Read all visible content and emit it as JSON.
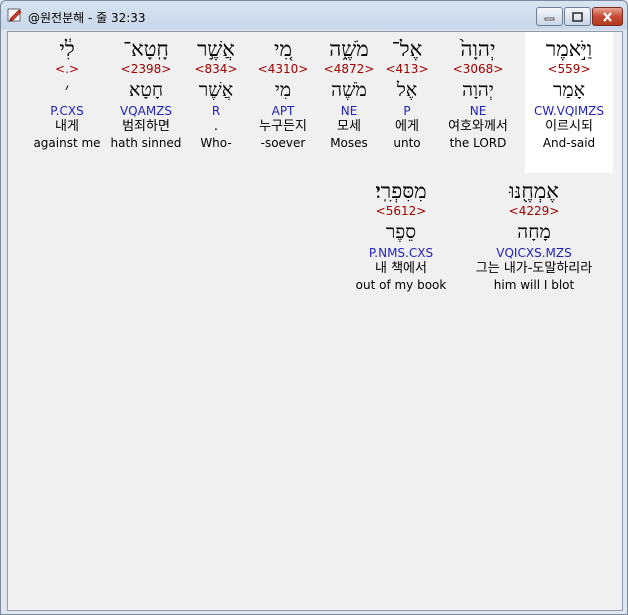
{
  "window": {
    "title": "@원전분해 - 줄 32:33",
    "controls": {
      "minimize": "minimize",
      "maximize": "maximize",
      "close": "close"
    }
  },
  "words": [
    {
      "hebrew": "וַיֹּ֣אמֶר",
      "strong": "<559>",
      "root": "אָמַר",
      "morph": "CW.VQIMZS",
      "korean": "이르시되",
      "english": "And-said"
    },
    {
      "hebrew": "יְהוָה֙",
      "strong": "<3068>",
      "root": "יְהוָה",
      "morph": "NE",
      "korean": "여호와께서",
      "english": "the LORD"
    },
    {
      "hebrew": "אֶל־",
      "strong": "<413>",
      "root": "אֶל",
      "morph": "P",
      "korean": "에게",
      "english": "unto"
    },
    {
      "hebrew": "מֹשֶׁ֑ה",
      "strong": "<4872>",
      "root": "מֹשֶׁה",
      "morph": "NE",
      "korean": "모세",
      "english": "Moses"
    },
    {
      "hebrew": "מִ֚י",
      "strong": "<4310>",
      "root": "מִי",
      "morph": "APT",
      "korean": "누구든지",
      "english": "-soever"
    },
    {
      "hebrew": "אֲשֶׁ֣ר",
      "strong": "<834>",
      "root": "אֲשֶׁר",
      "morph": "R",
      "korean": ".",
      "english": "Who-"
    },
    {
      "hebrew": "חָֽטָא־",
      "strong": "<2398>",
      "root": "חָטָא",
      "morph": "VQAMZS",
      "korean": "범죄하면",
      "english": "hath sinned"
    },
    {
      "hebrew": "לִ֔י",
      "strong": "<.>",
      "root": "׳",
      "morph": "P.CXS",
      "korean": "내게",
      "english": "against me"
    },
    {
      "hebrew": "אֶמְחֶ֖נּוּ",
      "strong": "<4229>",
      "root": "מָחָה",
      "morph": "VQICXS.MZS",
      "korean": "그는 내가-도말하리라",
      "english": "him will I blot"
    },
    {
      "hebrew": "מִסִּפְרִֽי׃",
      "strong": "<5612>",
      "root": "סֵפֶר",
      "morph": "P.NMS.CXS",
      "korean": "내 책에서",
      "english": "out of my book"
    }
  ]
}
